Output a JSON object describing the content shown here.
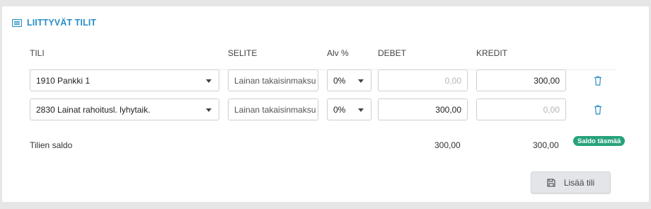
{
  "section": {
    "title": "LIITTYVÄT TILIT",
    "icon": "list-icon"
  },
  "columns": {
    "tili": "TILI",
    "selite": "SELITE",
    "alv": "Alv %",
    "debet": "DEBET",
    "kredit": "KREDIT"
  },
  "rows": [
    {
      "account": "1910 Pankki 1",
      "selite_placeholder": "Lainan takaisinmaksu",
      "alv": "0%",
      "debet_value": "",
      "debet_placeholder": "0,00",
      "kredit_value": "300,00",
      "kredit_placeholder": ""
    },
    {
      "account": "2830 Lainat rahoitusl. lyhytaik.",
      "selite_placeholder": "Lainan takaisinmaksu",
      "alv": "0%",
      "debet_value": "300,00",
      "debet_placeholder": "",
      "kredit_value": "",
      "kredit_placeholder": "0,00"
    }
  ],
  "saldo": {
    "label": "Tilien saldo",
    "debet": "300,00",
    "kredit": "300,00",
    "badge": "Saldo täsmää",
    "badge_color": "#27a27a"
  },
  "add_button": {
    "label": "Lisää tili",
    "icon": "save-icon"
  },
  "colors": {
    "accent": "#2a8fc7",
    "trash": "#2a8fc7"
  }
}
